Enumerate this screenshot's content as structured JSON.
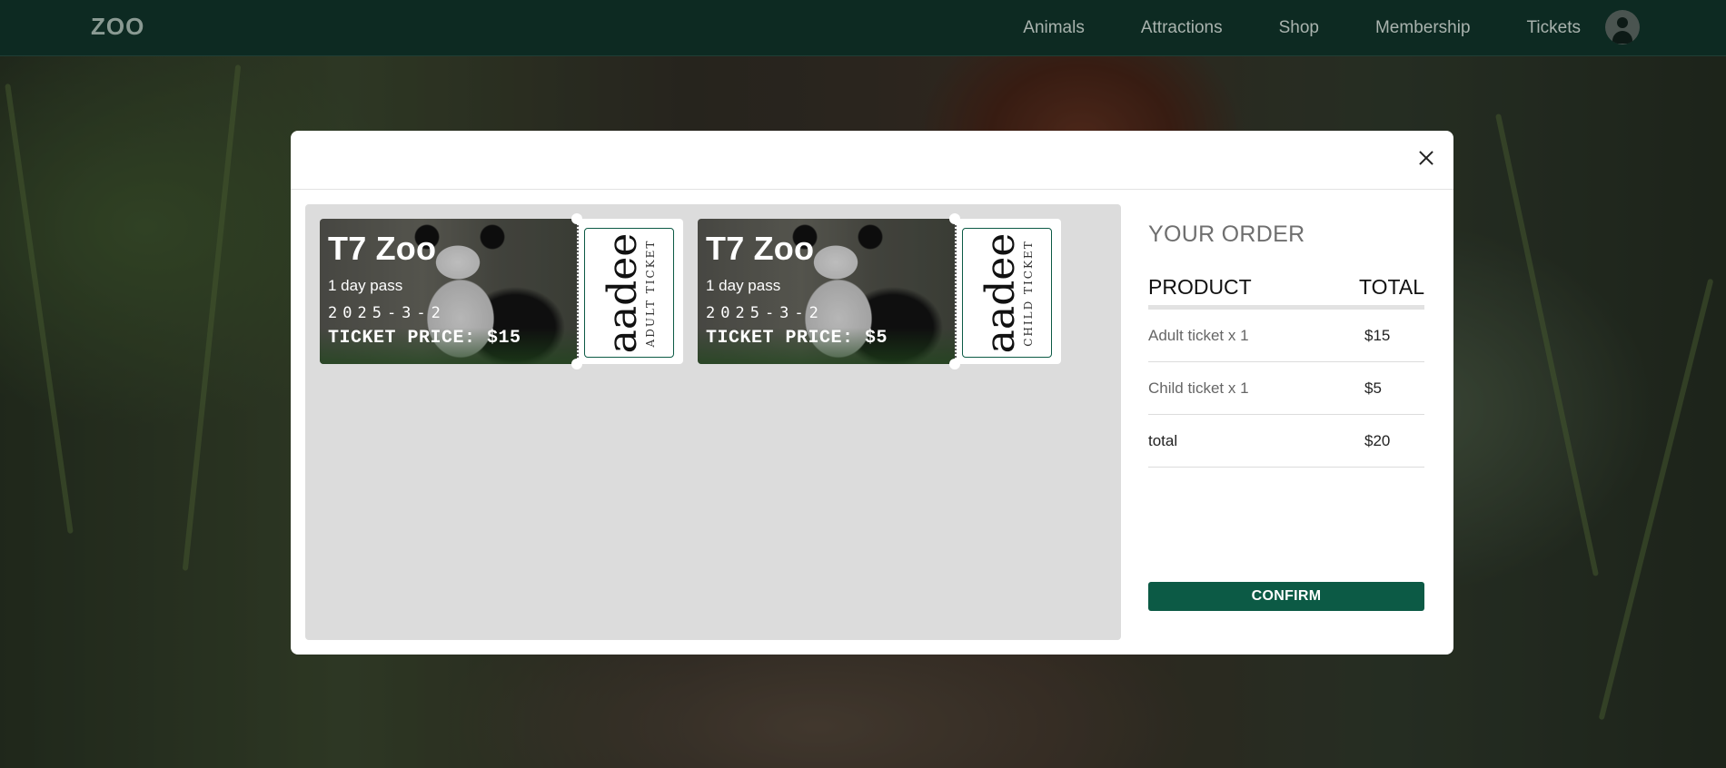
{
  "nav": {
    "logo": "ZOO",
    "links": [
      "Animals",
      "Attractions",
      "Shop",
      "Membership",
      "Tickets"
    ]
  },
  "tickets": [
    {
      "zoo": "T7 Zoo",
      "pass": "1 day pass",
      "date": "2025-3-2",
      "price": "TICKET PRICE: $15",
      "kind": "ADULT TICKET",
      "brand": "aadee"
    },
    {
      "zoo": "T7 Zoo",
      "pass": "1 day pass",
      "date": "2025-3-2",
      "price": "TICKET PRICE: $5",
      "kind": "CHILD TICKET",
      "brand": "aadee"
    }
  ],
  "order": {
    "title": "YOUR ORDER",
    "col_product": "PRODUCT",
    "col_total": "TOTAL",
    "rows": [
      {
        "label": "Adult ticket x 1",
        "value": "$15"
      },
      {
        "label": "Child ticket x 1",
        "value": "$5"
      }
    ],
    "total_label": "total",
    "total_value": "$20",
    "confirm_label": "CONFIRM"
  },
  "colors": {
    "nav_bg": "#0d2a22",
    "accent": "#0c5a45",
    "ticket_area_bg": "#dcdcdc"
  }
}
